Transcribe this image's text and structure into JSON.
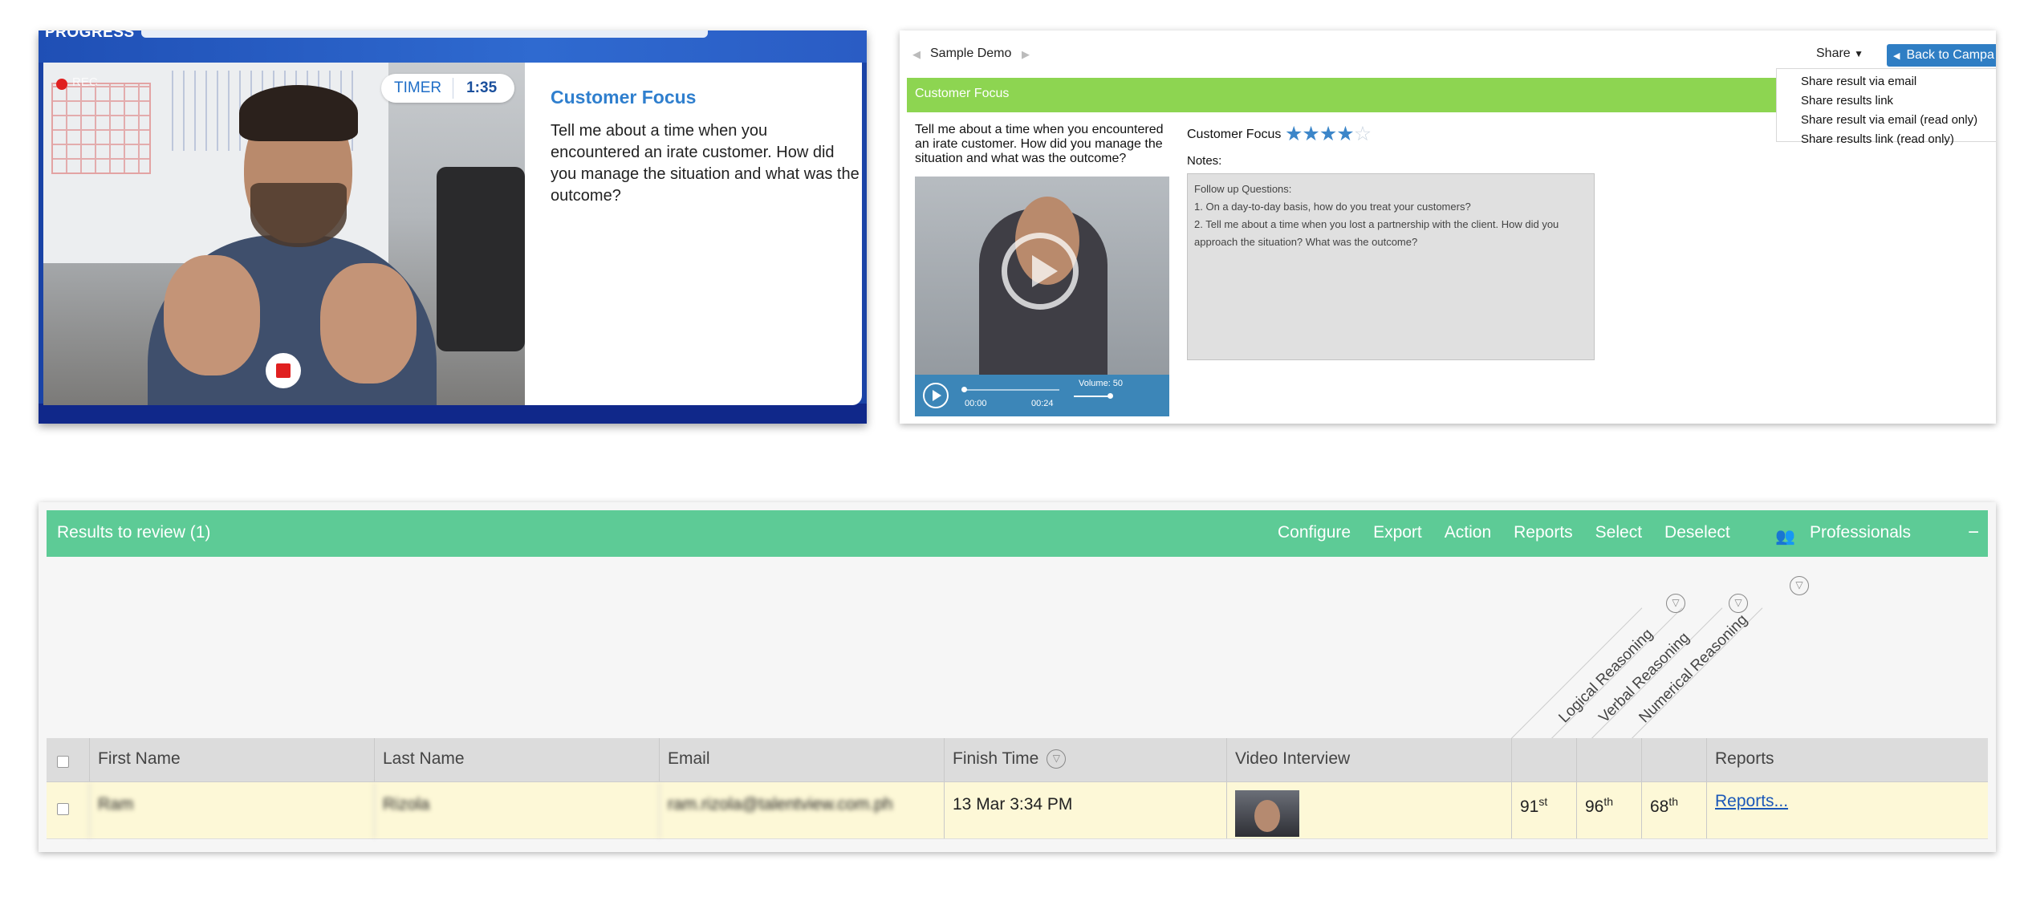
{
  "recording": {
    "progress_label": "PROGRESS",
    "rec_indicator": "REC",
    "timer_label": "TIMER",
    "timer_value": "1:35",
    "question_title": "Customer Focus",
    "question_text": "Tell me about a time when you encountered an irate customer. How did you manage the situation and what was the outcome?"
  },
  "review": {
    "nav_title": "Sample Demo",
    "share_label": "Share",
    "back_label": "Back to Campa",
    "section_title": "Customer Focus",
    "question_text": "Tell me about a time when you encountered an irate customer. How did you manage the situation and what was the outcome?",
    "competency_label": "Customer Focus",
    "rating": 4,
    "rating_max": 5,
    "notes_label": "Notes:",
    "notes_lines": [
      "Follow up Questions:",
      "1. On a day-to-day basis, how do you treat your customers?",
      "2. Tell me about a time when you lost a partnership with the client. How did you approach the situation? What was the outcome?"
    ],
    "player": {
      "current_time": "00:00",
      "duration": "00:24",
      "volume_label": "Volume: 50"
    },
    "share_menu": [
      "Share result via email",
      "Share results link",
      "Share result via email (read only)",
      "Share results link (read only)"
    ]
  },
  "results": {
    "title": "Results to review (1)",
    "actions": [
      "Configure",
      "Export",
      "Action",
      "Reports",
      "Select",
      "Deselect"
    ],
    "professionals_label": "Professionals",
    "collapse_label": "−",
    "score_columns": [
      "Logical Reasoning",
      "Verbal Reasoning",
      "Numerical Reasoning"
    ],
    "headers": {
      "first_name": "First Name",
      "last_name": "Last Name",
      "email": "Email",
      "finish_time": "Finish Time",
      "video": "Video Interview",
      "reports": "Reports"
    },
    "row": {
      "first_name": "Ram",
      "last_name": "Rizola",
      "email": "ram.rizola@talentview.com.ph",
      "finish_time": "13 Mar 3:34 PM",
      "scores": [
        {
          "num": "91",
          "suffix": "st"
        },
        {
          "num": "96",
          "suffix": "th"
        },
        {
          "num": "68",
          "suffix": "th"
        }
      ],
      "reports_link": "Reports..."
    }
  },
  "colors": {
    "rec_blue": "#1a43a6",
    "accent_blue": "#2f7fce",
    "review_green": "#8dd551",
    "results_green": "#5dcb96",
    "row_highlight": "#fdf8d7"
  }
}
